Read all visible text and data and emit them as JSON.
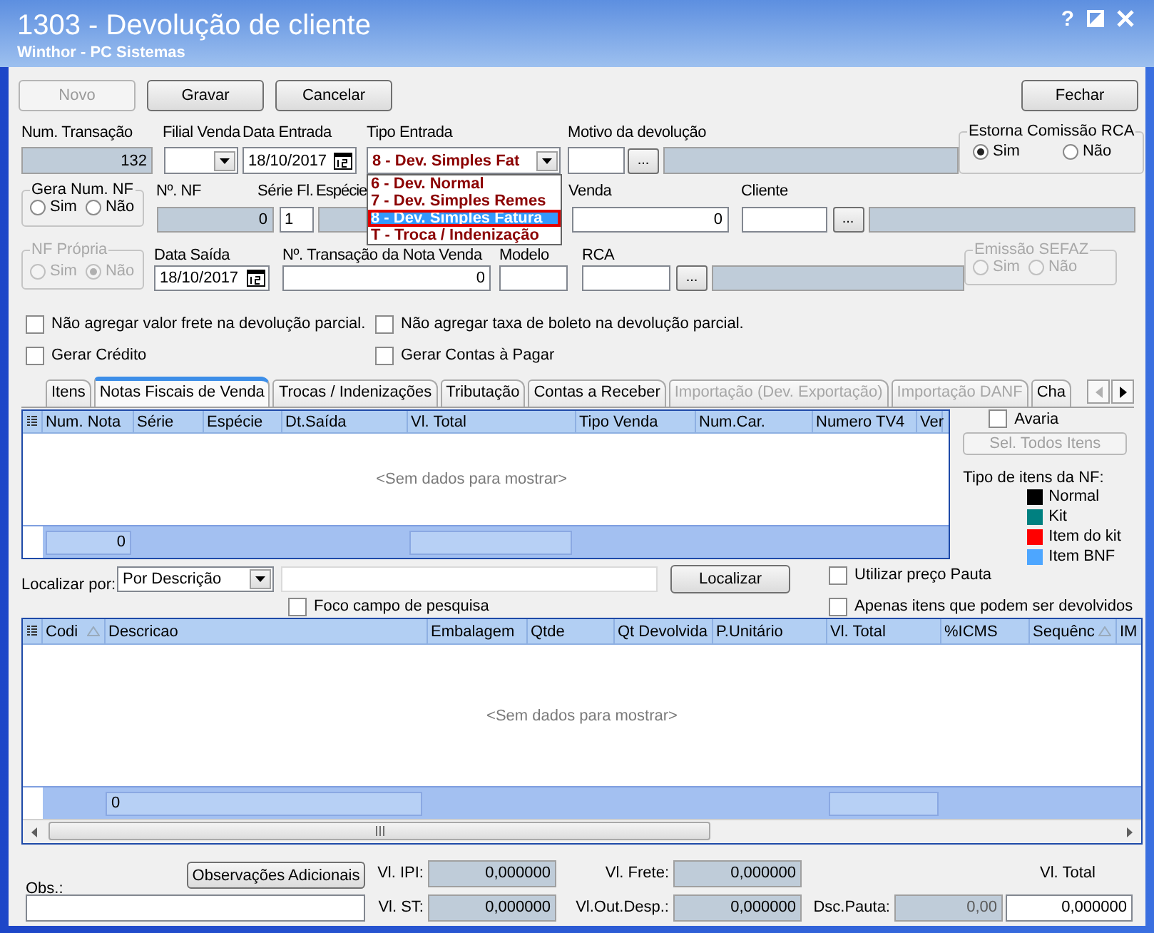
{
  "window": {
    "title": "1303 - Devolução de cliente",
    "subtitle": "Winthor - PC Sistemas",
    "help_button": "?"
  },
  "toolbar": [
    {
      "label": "Novo",
      "disabled": true
    },
    {
      "label": "Gravar",
      "disabled": false
    },
    {
      "label": "Cancelar",
      "disabled": false
    },
    {
      "label": "Fechar",
      "disabled": false
    }
  ],
  "num_transacao": {
    "label": "Num. Transação",
    "value": "132"
  },
  "filial_venda": {
    "label": "Filial Venda"
  },
  "data_entrada": {
    "label": "Data Entrada",
    "value": "18/10/2017"
  },
  "tipo_entrada": {
    "label": "Tipo Entrada",
    "value": "8 - Dev. Simples Fat",
    "expanded": true,
    "options": [
      {
        "label": "6 - Dev. Normal",
        "selected": false
      },
      {
        "label": "7 - Dev. Simples Remes",
        "selected": false
      },
      {
        "label": "8 - Dev. Simples Fatura",
        "selected": true
      },
      {
        "label": "T - Troca / Indenização",
        "selected": false
      }
    ]
  },
  "motivo": {
    "label": "Motivo da devolução",
    "lookup": "..."
  },
  "estorna_comissao": {
    "title": "Estorna Comissão RCA",
    "disabled": false,
    "options": [
      {
        "label": "Sim",
        "selected": true
      },
      {
        "label": "Não",
        "selected": false
      }
    ]
  },
  "gera_num_nf": {
    "title": "Gera Num. NF",
    "disabled": false,
    "options": [
      {
        "label": "Sim",
        "selected": false
      },
      {
        "label": "Não",
        "selected": false
      }
    ]
  },
  "num_nf": {
    "label": "Nº. NF",
    "value": "0"
  },
  "serie": {
    "label": "Série Fl.",
    "value": "1"
  },
  "especie": {
    "label": "Espécie"
  },
  "venda": {
    "label": "Venda",
    "value": "0"
  },
  "cliente": {
    "label": "Cliente",
    "lookup": "..."
  },
  "nf_propria": {
    "title": "NF Própria",
    "disabled": true,
    "options": [
      {
        "label": "Sim",
        "selected": false
      },
      {
        "label": "Não",
        "selected": true
      }
    ]
  },
  "data_saida": {
    "label": "Data Saída",
    "value": "18/10/2017"
  },
  "transacao_nota_venda": {
    "label": "Nº. Transação da Nota Venda",
    "value": "0"
  },
  "modelo": {
    "label": "Modelo"
  },
  "rca": {
    "label": "RCA",
    "lookup": "..."
  },
  "emissao_sefaz": {
    "title": "Emissão SEFAZ",
    "disabled": true,
    "options": [
      {
        "label": "Sim",
        "selected": false
      },
      {
        "label": "Não",
        "selected": false
      }
    ]
  },
  "checks": [
    {
      "label": "Não agregar valor frete na devolução parcial.",
      "checked": false
    },
    {
      "label": "Não agregar taxa de boleto na devolução parcial.",
      "checked": false
    },
    {
      "label": "Gerar Crédito",
      "checked": false
    },
    {
      "label": "Gerar Contas à Pagar",
      "checked": false
    }
  ],
  "tabs": [
    {
      "label": "Itens",
      "selected": false,
      "disabled": false
    },
    {
      "label": "Notas Fiscais de Venda",
      "selected": true,
      "disabled": false
    },
    {
      "label": "Trocas / Indenizações",
      "selected": false,
      "disabled": false
    },
    {
      "label": "Tributação",
      "selected": false,
      "disabled": false
    },
    {
      "label": "Contas a Receber",
      "selected": false,
      "disabled": false
    },
    {
      "label": "Importação (Dev. Exportação)",
      "selected": false,
      "disabled": true
    },
    {
      "label": "Importação DANF",
      "selected": false,
      "disabled": true
    },
    {
      "label": "Cha",
      "selected": false,
      "disabled": false
    }
  ],
  "tab_scroll": [
    {
      "kind": "left",
      "disabled": true
    },
    {
      "kind": "right",
      "disabled": false
    }
  ],
  "notas_grid": {
    "columns": [
      {
        "label": "Num. Nota"
      },
      {
        "label": "Série"
      },
      {
        "label": "Espécie"
      },
      {
        "label": "Dt.Saída"
      },
      {
        "label": "Vl. Total"
      },
      {
        "label": "Tipo Venda"
      },
      {
        "label": "Num.Car."
      },
      {
        "label": "Numero TV4"
      },
      {
        "label": "Ver"
      }
    ],
    "empty_text": "<Sem dados para mostrar>",
    "footer_value": "0"
  },
  "avaria": {
    "label": "Avaria",
    "checked": false
  },
  "sel_todos": {
    "label": "Sel. Todos Itens",
    "disabled": true
  },
  "legend": {
    "title": "Tipo de itens da NF:",
    "items": [
      {
        "label": "Normal",
        "color": "#000000"
      },
      {
        "label": "Kit",
        "color": "#008080"
      },
      {
        "label": "Item do kit",
        "color": "#ff0000"
      },
      {
        "label": "Item BNF",
        "color": "#4da6ff"
      }
    ]
  },
  "search": {
    "label": "Localizar por:",
    "mode": "Por Descrição",
    "button": "Localizar"
  },
  "search_checks": [
    {
      "label": "Utilizar preço Pauta",
      "checked": false
    },
    {
      "label": "Foco campo de pesquisa",
      "checked": false
    },
    {
      "label": "Apenas itens que podem ser devolvidos",
      "checked": false
    }
  ],
  "itens_grid": {
    "columns": [
      {
        "label": "Codi",
        "sorted": true
      },
      {
        "label": "Descricao",
        "sorted": false
      },
      {
        "label": "Embalagem",
        "sorted": false
      },
      {
        "label": "Qtde",
        "sorted": false
      },
      {
        "label": "Qt Devolvida",
        "sorted": false
      },
      {
        "label": "P.Unitário",
        "sorted": false
      },
      {
        "label": "Vl. Total",
        "sorted": false
      },
      {
        "label": "%ICMS",
        "sorted": false
      },
      {
        "label": "Sequênc",
        "sorted": true
      },
      {
        "label": "IM",
        "sorted": false
      }
    ],
    "empty_text": "<Sem dados para mostrar>",
    "footer_value": "0"
  },
  "obs": {
    "label": "Obs.:",
    "button": "Observações Adicionais"
  },
  "totals": [
    {
      "label": "Vl. IPI:",
      "value": "0,000000"
    },
    {
      "label": "Vl. Frete:",
      "value": "0,000000"
    },
    {
      "label": "Vl. ST:",
      "value": "0,000000"
    },
    {
      "label": "Vl.Out.Desp.:",
      "value": "0,000000"
    }
  ],
  "dsc_pauta": {
    "label": "Dsc.Pauta:",
    "value": "0,00"
  },
  "vl_total": {
    "label": "Vl. Total",
    "value": "0,000000"
  }
}
